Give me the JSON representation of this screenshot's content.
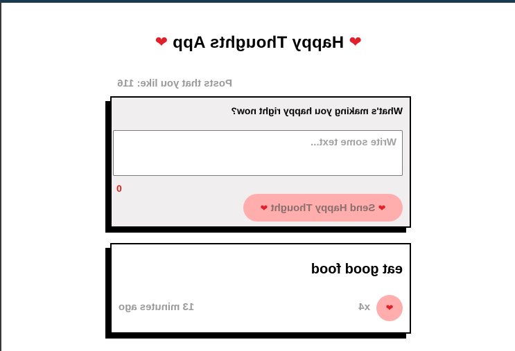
{
  "app": {
    "title": "Happy Thoughts App",
    "title_icon": "heart-icon",
    "likes_label": "Posts that you like: 116"
  },
  "form": {
    "question": "What's making you happy right now?",
    "input_value": "",
    "input_placeholder": "Write some text...",
    "char_count": "0",
    "send_label": "Send Happy Thought",
    "send_icon": "heart-icon"
  },
  "thoughts": [
    {
      "message": "eat good food",
      "likes": "x4",
      "time": "13 minutes ago",
      "like_icon": "heart-icon"
    }
  ],
  "colors": {
    "heart": "#e0202a",
    "button_pink": "#ffadad",
    "form_background": "#f0eeee",
    "muted_text": "#9a9a9a",
    "counter_red": "#e02020",
    "frame_top": "#1a3a4f"
  }
}
